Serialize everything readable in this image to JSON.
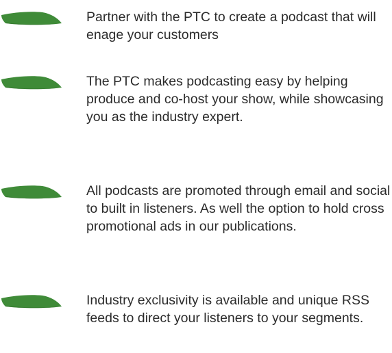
{
  "colors": {
    "bullet_fill": "#3f8b38",
    "bullet_shadow": "#2f6f2a",
    "text": "#2b2b2b"
  },
  "bullets": [
    {
      "icon": "green-leaf-bullet-icon",
      "text": "Partner with the PTC to create a podcast that will enage your customers"
    },
    {
      "icon": "green-leaf-bullet-icon",
      "text": "The PTC makes podcasting easy by helping produce and co-host your show, while showcasing you as the industry expert."
    },
    {
      "icon": "green-leaf-bullet-icon",
      "text": "All podcasts are promoted through email and social to built in listeners. As well the option to hold cross promotional ads in our publications."
    },
    {
      "icon": "green-leaf-bullet-icon",
      "text": "Industry exclusivity is available and unique RSS feeds to direct your listeners to your segments."
    }
  ]
}
